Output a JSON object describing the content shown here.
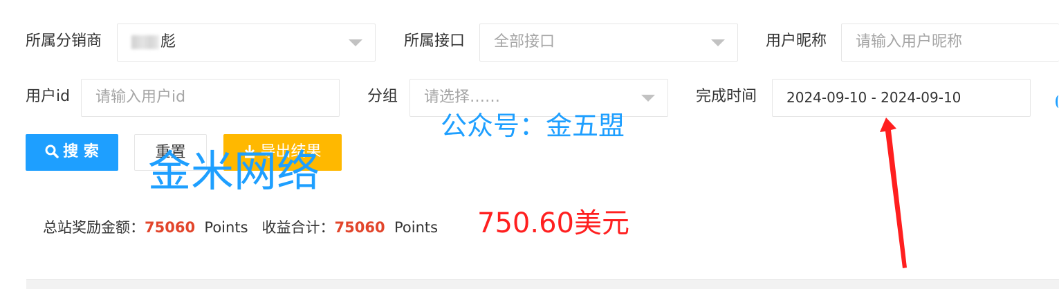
{
  "filters": {
    "row1": {
      "distributor_label": "所属分销商",
      "distributor_value": "彪",
      "interface_label": "所属接口",
      "interface_value": "全部接口",
      "nickname_label": "用户昵称",
      "nickname_placeholder": "请输入用户昵称"
    },
    "row2": {
      "userid_label": "用户id",
      "userid_placeholder": "请输入用户id",
      "group_label": "分组",
      "group_placeholder": "请选择……",
      "time_label": "完成时间",
      "time_value": "2024-09-10 - 2024-09-10"
    }
  },
  "buttons": {
    "search_label": "搜 索",
    "reset_label": "重置",
    "export_label": "导出结果"
  },
  "overlays": {
    "wechat": "公众号：金五盟",
    "watermark": "金米网络"
  },
  "stats": {
    "total_reward_label": "总站奖励金额：",
    "total_reward_value": "75060",
    "total_reward_unit": "Points",
    "income_label": "收益合计：",
    "income_value": "75060",
    "income_unit": "Points",
    "usd_value": "750.60美元"
  },
  "colors": {
    "primary": "#1e9fff",
    "warning": "#ffb800",
    "highlight": "#e2452b",
    "annotation_red": "#ff1f1f"
  }
}
